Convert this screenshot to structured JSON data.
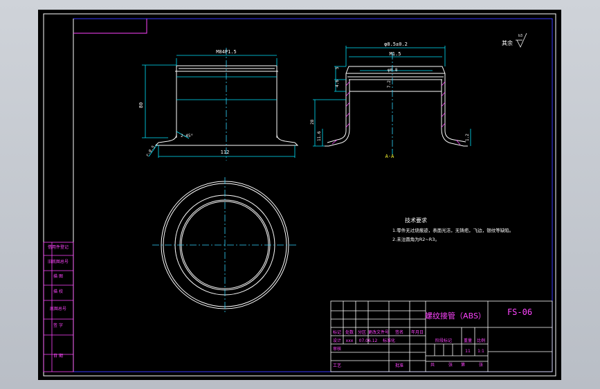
{
  "drawing": {
    "surface_note": "其余",
    "surface_symbol": "b3",
    "dims": {
      "outer_dia": "M84P1.5",
      "height_left": "80",
      "chamfer": "2-45°",
      "fillet": "r-0.5",
      "base_width": "112",
      "inner_dia": "φ8.5±0.2",
      "thread": "M1.5",
      "wall": "φ0.8",
      "v5": "5",
      "v46": "4.6",
      "v28": "28",
      "v116": "11.6",
      "v72": "7.2",
      "v12": "1.2",
      "section": "A-A"
    },
    "tech_req": {
      "title": "技术要求",
      "line1": "1.零件无过烧痕迹，表面光洁，无铸疤，飞边，银纹等缺陷。",
      "line2": "2.未注圆角为R2~R3。"
    }
  },
  "side_table": [
    "借用件登记",
    "旧底图总号",
    "描 图",
    "描 校",
    "底图总号",
    "签 字",
    "日 期"
  ],
  "title_block": {
    "part_name": "螺纹接管（ABS）",
    "drawing_no": "FS-06",
    "header_cells": [
      "标记",
      "处数",
      "分区",
      "更改文件号",
      "签名",
      "年月日"
    ],
    "row_design": [
      "设计",
      "xxx",
      "07.06.12",
      "标准化"
    ],
    "row_check": "审核",
    "row_process": "工艺",
    "row_approve": "批准",
    "stage_label": "阶段标记",
    "weight_label": "重量",
    "scale_label": "比例",
    "weight_value": "11",
    "scale_value": "1:1",
    "sheets": [
      "共",
      "张",
      "第",
      "张"
    ]
  },
  "colors": {
    "frame": "#ffffff",
    "border": "#1a1aff",
    "geometry": "#ffffff",
    "centerline": "#33d6ff",
    "dimension": "#00e5ff",
    "table": "#ff44ff",
    "text_yellow": "#ffff33"
  }
}
